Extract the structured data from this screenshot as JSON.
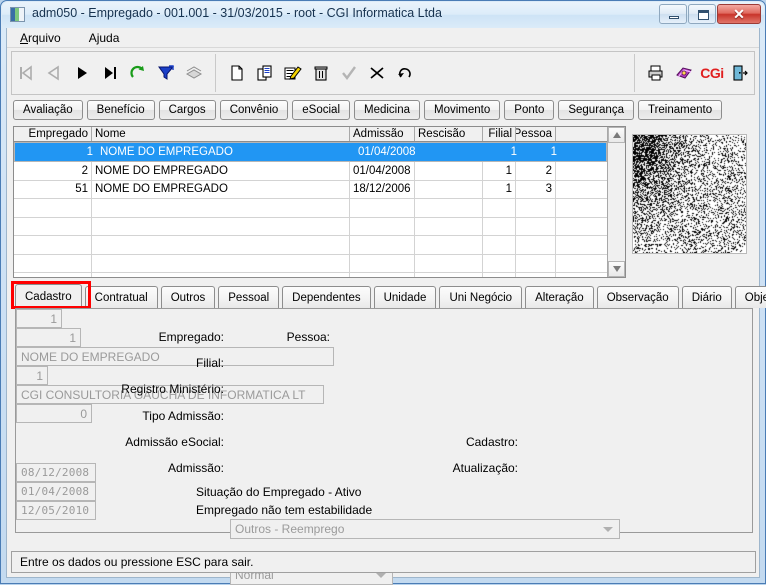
{
  "window": {
    "title": "adm050 - Empregado - 001.001 - 31/03/2015 - root - CGI Informatica Ltda",
    "icon": "app-icon",
    "minimize_label": "",
    "maximize_label": "",
    "close_label": "✕"
  },
  "menu": {
    "items": [
      {
        "label": "Arquivo",
        "accel": "A"
      },
      {
        "label": "Ajuda",
        "accel": ""
      }
    ]
  },
  "toolbar": {
    "nav_buttons": [
      {
        "name": "first-record-button",
        "icon": "first-record-icon",
        "enabled": false
      },
      {
        "name": "previous-record-button",
        "icon": "previous-record-icon",
        "enabled": false
      },
      {
        "name": "next-record-button",
        "icon": "next-record-icon",
        "enabled": true
      },
      {
        "name": "last-record-button",
        "icon": "last-record-icon",
        "enabled": true
      },
      {
        "name": "refresh-button",
        "icon": "refresh-arrow-icon",
        "enabled": true
      },
      {
        "name": "filter-button",
        "icon": "filter-funnel-icon",
        "enabled": true
      },
      {
        "name": "stack-button",
        "icon": "stack-layers-icon",
        "enabled": false
      }
    ],
    "edit_buttons": [
      {
        "name": "new-record-button",
        "icon": "new-document-icon",
        "enabled": true
      },
      {
        "name": "copy-record-button",
        "icon": "copy-icon",
        "enabled": true
      },
      {
        "name": "edit-record-button",
        "icon": "edit-pencil-icon",
        "enabled": true
      },
      {
        "name": "delete-record-button",
        "icon": "trash-icon",
        "enabled": true
      },
      {
        "name": "confirm-button",
        "icon": "checkmark-icon",
        "enabled": false
      },
      {
        "name": "cancel-button",
        "icon": "cancel-x-icon",
        "enabled": true
      },
      {
        "name": "undo-button",
        "icon": "undo-arrow-icon",
        "enabled": true
      }
    ],
    "right_buttons": [
      {
        "name": "print-button",
        "icon": "printer-icon"
      },
      {
        "name": "help-book-button",
        "icon": "purple-book-icon"
      },
      {
        "name": "cgi-logo-button",
        "icon": "cgi-logo-icon"
      },
      {
        "name": "exit-button",
        "icon": "exit-door-icon"
      }
    ],
    "cgi_logo_text": "CG",
    "cgi_logo_accent": "i"
  },
  "modules": {
    "buttons": [
      "Avaliação",
      "Benefício",
      "Cargos",
      "Convênio",
      "eSocial",
      "Medicina",
      "Movimento",
      "Ponto",
      "Segurança",
      "Treinamento"
    ]
  },
  "grid": {
    "columns": [
      "Empregado",
      "Nome",
      "Admissão",
      "Rescisão",
      "Filial",
      "Pessoa"
    ],
    "rows": [
      {
        "empregado": "1",
        "nome": "NOME DO EMPREGADO",
        "admissao": "01/04/2008",
        "rescisao": "",
        "filial": "1",
        "pessoa": "1",
        "selected": true
      },
      {
        "empregado": "2",
        "nome": "NOME DO EMPREGADO",
        "admissao": "01/04/2008",
        "rescisao": "",
        "filial": "1",
        "pessoa": "2",
        "selected": false
      },
      {
        "empregado": "51",
        "nome": "NOME DO EMPREGADO",
        "admissao": "18/12/2006",
        "rescisao": "",
        "filial": "1",
        "pessoa": "3",
        "selected": false
      }
    ],
    "empty_rows": 5,
    "scroll_up": "▲",
    "scroll_down": "▼",
    "selection_color": "#2196f3"
  },
  "photo": {
    "name": "employee-photo"
  },
  "tabs": {
    "items": [
      "Cadastro",
      "Contratual",
      "Outros",
      "Pessoal",
      "Dependentes",
      "Unidade",
      "Uni Negócio",
      "Alteração",
      "Observação",
      "Diário",
      "Objetos"
    ],
    "active": "Cadastro",
    "highlight_color": "#ff0000"
  },
  "form": {
    "empregado_label": "Empregado:",
    "empregado_value": "1",
    "pessoa_label": "Pessoa:",
    "pessoa_value": "1",
    "nome_value": "NOME DO EMPREGADO",
    "filial_label": "Filial:",
    "filial_value": "1",
    "filial_nome_value": "CGI CONSULTORIA GAUCHA DE INFORMATICA LT",
    "registro_ministerio_label": "Registro Ministério:",
    "registro_ministerio_value": "0",
    "tipo_admissao_label": "Tipo Admissão:",
    "tipo_admissao_value": "Outros - Reemprego",
    "admissao_esocial_label": "Admissão eSocial:",
    "admissao_esocial_value": "Normal",
    "cadastro_label": "Cadastro:",
    "cadastro_value": "08/12/2008",
    "admissao_label": "Admissão:",
    "admissao_value": "01/04/2008",
    "atualizacao_label": "Atualização:",
    "atualizacao_value": "12/05/2010",
    "situacao_text": "Situação do Empregado - Ativo",
    "estabilidade_text": "Empregado não tem estabilidade"
  },
  "statusbar": {
    "message": "Entre os dados ou pressione ESC para sair."
  }
}
